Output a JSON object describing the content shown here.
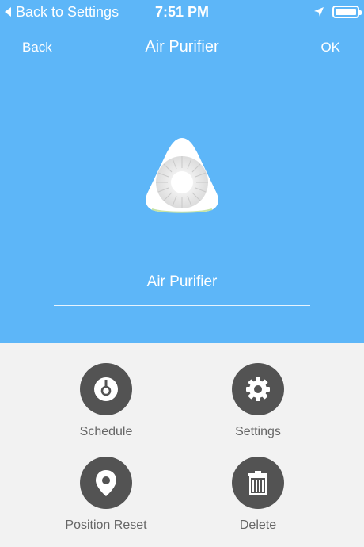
{
  "status_bar": {
    "back_label": "Back to Settings",
    "time": "7:51 PM"
  },
  "nav": {
    "back_label": "Back",
    "title": "Air Purifier",
    "ok_label": "OK"
  },
  "device": {
    "icon": "air-purifier-icon",
    "name_value": "Air Purifier"
  },
  "actions": {
    "schedule": {
      "label": "Schedule",
      "icon": "clock-icon"
    },
    "settings": {
      "label": "Settings",
      "icon": "gear-icon"
    },
    "position_reset": {
      "label": "Position Reset",
      "icon": "location-pin-icon"
    },
    "delete": {
      "label": "Delete",
      "icon": "trash-icon"
    }
  },
  "colors": {
    "header_bg": "#5db6f8",
    "body_bg": "#f2f2f2",
    "button_circle": "#535353",
    "label_text": "#666666"
  }
}
